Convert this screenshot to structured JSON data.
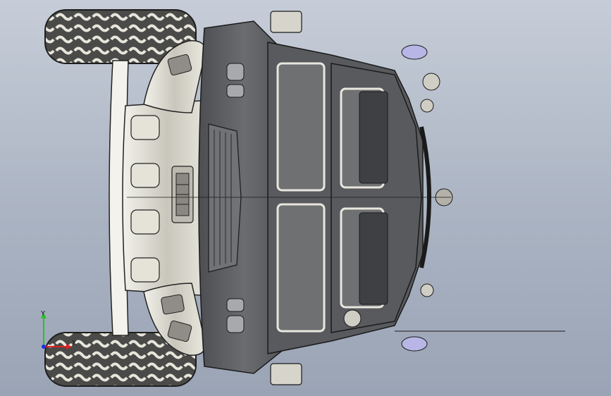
{
  "viewport": {
    "background_top": "#c6cdd8",
    "background_bottom": "#9aa4b5"
  },
  "model": {
    "body_color": "#5d5f63",
    "body_dark": "#3f4145",
    "body_light": "#8b8d92",
    "chrome_color": "#dcdad0",
    "tire_color": "#4a4a48",
    "glass_color": "#6c6e70",
    "accent_color": "#b8b6e6"
  },
  "triad": {
    "y_label": "Y",
    "x_label": "X",
    "y_color": "#29c229",
    "x_color": "#e02020",
    "z_color": "#2030e0"
  }
}
